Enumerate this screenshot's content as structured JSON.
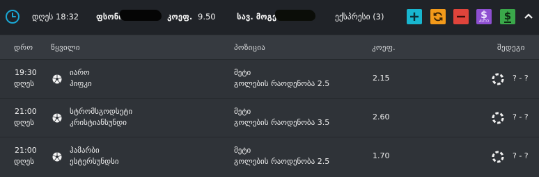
{
  "header": {
    "time_label": "დღეს 18:32",
    "stake_label": "ფსონი",
    "odds_label": "კოეფ.",
    "odds_value": "9.50",
    "possible_win_label": "სავ. მოგება",
    "express_label": "ექსპრესი (3)",
    "buttons": [
      {
        "name": "add",
        "color": "#18b6cf"
      },
      {
        "name": "refresh",
        "color": "#f39a1a"
      },
      {
        "name": "remove",
        "color": "#e0443b"
      },
      {
        "name": "auto-dollar",
        "color": "#8e4fd1",
        "sublabel": "AUTO"
      },
      {
        "name": "dollar",
        "color": "#3aa84a"
      }
    ]
  },
  "columns": {
    "time": "დრო",
    "event": "წყვილი",
    "position": "პოზიცია",
    "odds": "კოეფ.",
    "result": "შედეგი"
  },
  "rows": [
    {
      "time": "19:30",
      "day": "დღეს",
      "team1": "იარო",
      "team2": "ჰიფკი",
      "market": "მეტი",
      "selection": "გოლების რაოდენობა 2.5",
      "odds": "2.15",
      "result": "? - ?"
    },
    {
      "time": "21:00",
      "day": "დღეს",
      "team1": "სტრომსგოდსეტი",
      "team2": "კრისტიანსუნდი",
      "market": "მეტი",
      "selection": "გოლების რაოდენობა 3.5",
      "odds": "2.60",
      "result": "? - ?"
    },
    {
      "time": "21:00",
      "day": "დღეს",
      "team1": "ჰამარბი",
      "team2": "ესტერსუნდსი",
      "market": "მეტი",
      "selection": "გოლების რაოდენობა 2.5",
      "odds": "1.70",
      "result": "? - ?"
    }
  ]
}
